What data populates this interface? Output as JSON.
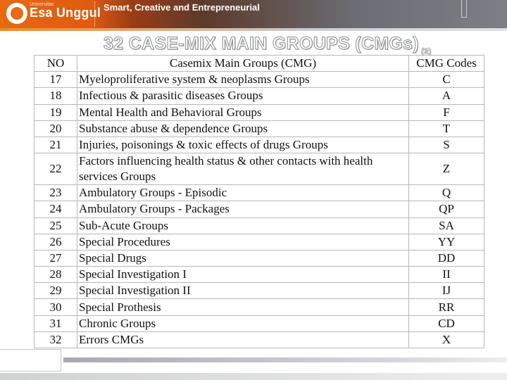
{
  "header": {
    "logo_small": "Universitas",
    "logo_text": "Esa Unggul",
    "tagline": "Smart, Creative and Entrepreneurial"
  },
  "title": {
    "main": "32 CASE-MIX MAIN GROUPS (CMGs)",
    "sub": "(2)"
  },
  "table": {
    "headers": {
      "no": "NO",
      "name": "Casemix Main Groups (CMG)",
      "code": "CMG Codes"
    },
    "rows": [
      {
        "no": "17",
        "name": "Myeloproliferative system & neoplasms Groups",
        "code": "C"
      },
      {
        "no": "18",
        "name": "Infectious & parasitic diseases Groups",
        "code": "A"
      },
      {
        "no": "19",
        "name": "Mental Health and Behavioral Groups",
        "code": "F"
      },
      {
        "no": "20",
        "name": "Substance abuse & dependence Groups",
        "code": "T"
      },
      {
        "no": "21",
        "name": "Injuries, poisonings & toxic effects of drugs Groups",
        "code": "S"
      },
      {
        "no": "22",
        "name": "Factors influencing health status & other contacts with health services Groups",
        "code": "Z"
      },
      {
        "no": "23",
        "name": "Ambulatory Groups - Episodic",
        "code": "Q"
      },
      {
        "no": "24",
        "name": "Ambulatory Groups - Packages",
        "code": "QP"
      },
      {
        "no": "25",
        "name": "Sub-Acute Groups",
        "code": "SA"
      },
      {
        "no": "26",
        "name": "Special Procedures",
        "code": "YY"
      },
      {
        "no": "27",
        "name": "Special Drugs",
        "code": "DD"
      },
      {
        "no": "28",
        "name": "Special Investigation I",
        "code": "II"
      },
      {
        "no": "29",
        "name": "Special Investigation II",
        "code": "IJ"
      },
      {
        "no": "30",
        "name": "Special Prothesis",
        "code": "RR"
      },
      {
        "no": "31",
        "name": "Chronic Groups",
        "code": "CD"
      },
      {
        "no": "32",
        "name": "Errors CMGs",
        "code": "X"
      }
    ]
  }
}
